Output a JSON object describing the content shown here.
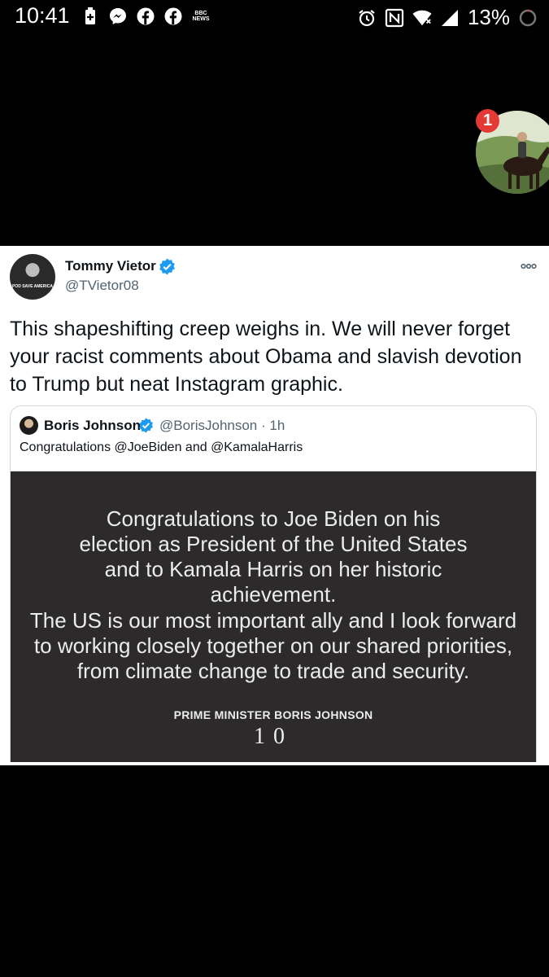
{
  "status_bar": {
    "time": "10:41",
    "battery_percent": "13%",
    "notification_icons": [
      "battery-saver-icon",
      "messenger-icon",
      "facebook-icon",
      "facebook-icon",
      "bbc-news-icon"
    ],
    "bbc_news_line1": "BBC",
    "bbc_news_line2": "NEWS",
    "system_icons": [
      "alarm-icon",
      "nfc-icon",
      "wifi-icon",
      "cell-signal-icon",
      "battery-icon"
    ]
  },
  "chat_bubble": {
    "badge_count": "1"
  },
  "tweet": {
    "author_name": "Tommy Vietor",
    "author_handle": "@TVietor08",
    "avatar_shirt_text": "POD SAVE AMERICA",
    "text": "This shapeshifting creep weighs in. We will never forget your racist comments about Obama and slavish devotion to Trump but neat Instagram graphic.",
    "quoted": {
      "author_name": "Boris Johnson",
      "meta": "@BorisJohnson · 1h",
      "text": "Congratulations @JoeBiden and @KamalaHarris",
      "image": {
        "paragraph1": "Congratulations to Joe Biden on his election as President of the United States and to Kamala Harris on her historic achievement.",
        "paragraph2": "The US is our most important ally and I look forward to working closely together on our shared priorities, from climate change to trade and security.",
        "signature": "PRIME MINISTER BORIS JOHNSON",
        "logo": "10"
      }
    }
  },
  "colors": {
    "verified_blue": "#1d9bf0",
    "badge_red": "#e53935",
    "image_bg": "#2c2a2b"
  }
}
